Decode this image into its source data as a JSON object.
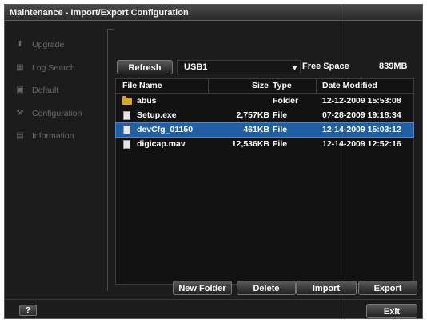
{
  "window": {
    "title": "Maintenance - Import/Export Configuration"
  },
  "sidebar": {
    "items": [
      {
        "label": "Upgrade",
        "icon": "upload-icon"
      },
      {
        "label": "Log Search",
        "icon": "log-icon"
      },
      {
        "label": "Default",
        "icon": "default-icon"
      },
      {
        "label": "Configuration",
        "icon": "wrench-icon"
      },
      {
        "label": "Information",
        "icon": "info-icon"
      }
    ]
  },
  "toolbar": {
    "refresh_label": "Refresh",
    "device_value": "USB1",
    "free_space_label": "Free Space",
    "free_space_value": "839MB"
  },
  "table": {
    "headers": {
      "name": "File Name",
      "size": "Size",
      "type": "Type",
      "date": "Date Modified"
    },
    "rows": [
      {
        "name": "abus",
        "size": "",
        "type": "Folder",
        "date": "12-12-2009 15:53:08",
        "icon": "folder-icon"
      },
      {
        "name": "Setup.exe",
        "size": "2,757KB",
        "type": "File",
        "date": "07-28-2009 19:18:34",
        "icon": "file-icon"
      },
      {
        "name": "devCfg_01150",
        "size": "461KB",
        "type": "File",
        "date": "12-14-2009 15:03:12",
        "icon": "file-icon"
      },
      {
        "name": "digicap.mav",
        "size": "12,536KB",
        "type": "File",
        "date": "12-14-2009 12:52:16",
        "icon": "file-icon"
      }
    ]
  },
  "actions": {
    "new_folder": "New Folder",
    "delete": "Delete",
    "import": "Import",
    "export": "Export"
  },
  "footer": {
    "help_label": "?",
    "exit_label": "Exit"
  },
  "colors": {
    "selection": "#1f5fa3",
    "background": "#1c1c1c",
    "folder": "#d9a520"
  }
}
